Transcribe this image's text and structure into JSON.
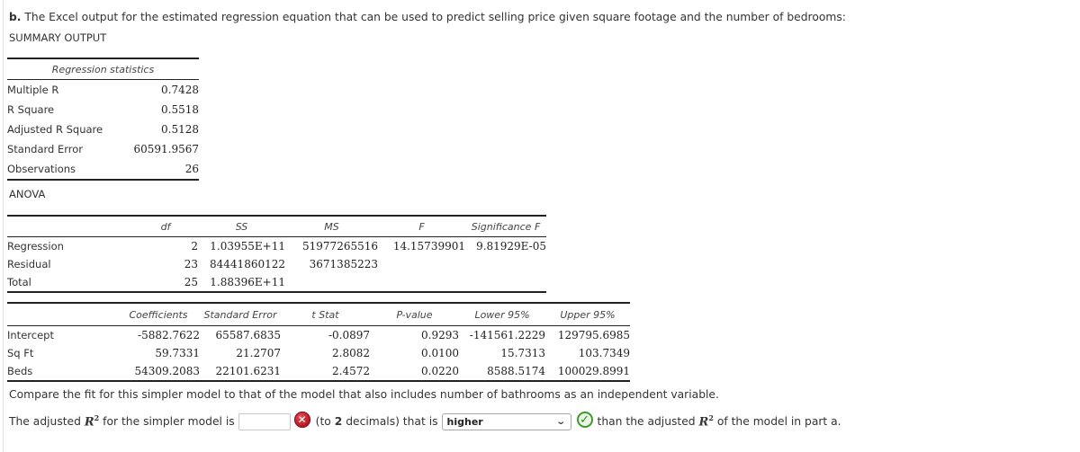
{
  "intro": {
    "part_label": "b.",
    "text": "The Excel output for the estimated regression equation that can be used to predict selling price given square footage and the number of bedrooms:"
  },
  "summary_title": "SUMMARY OUTPUT",
  "regression_statistics": {
    "header": "Regression statistics",
    "rows": [
      {
        "label": "Multiple R",
        "value": "0.7428"
      },
      {
        "label": "R Square",
        "value": "0.5518"
      },
      {
        "label": "Adjusted R Square",
        "value": "0.5128"
      },
      {
        "label": "Standard Error",
        "value": "60591.9567"
      },
      {
        "label": "Observations",
        "value": "26"
      }
    ]
  },
  "anova": {
    "title": "ANOVA",
    "headers": [
      "",
      "df",
      "SS",
      "MS",
      "F",
      "Significance F"
    ],
    "rows": [
      {
        "label": "Regression",
        "df": "2",
        "ss": "1.03955E+11",
        "ms": "51977265516",
        "f": "14.15739901",
        "sig_f": "9.81929E-05"
      },
      {
        "label": "Residual",
        "df": "23",
        "ss": "84441860122",
        "ms": "3671385223",
        "f": "",
        "sig_f": ""
      },
      {
        "label": "Total",
        "df": "25",
        "ss": "1.88396E+11",
        "ms": "",
        "f": "",
        "sig_f": ""
      }
    ]
  },
  "coefficients": {
    "headers": [
      "",
      "Coefficients",
      "Standard Error",
      "t Stat",
      "P-value",
      "Lower 95%",
      "Upper 95%"
    ],
    "rows": [
      {
        "label": "Intercept",
        "coef": "-5882.7622",
        "se": "65587.6835",
        "t": "-0.0897",
        "p": "0.9293",
        "lower": "-141561.2229",
        "upper": "129795.6985"
      },
      {
        "label": "Sq Ft",
        "coef": "59.7331",
        "se": "21.2707",
        "t": "2.8082",
        "p": "0.0100",
        "lower": "15.7313",
        "upper": "103.7349"
      },
      {
        "label": "Beds",
        "coef": "54309.2083",
        "se": "22101.6231",
        "t": "2.4572",
        "p": "0.0220",
        "lower": "8588.5174",
        "upper": "100029.8991"
      }
    ]
  },
  "compare_text": "Compare the fit for this simpler model to that of the model that also includes number of bathrooms as an independent variable.",
  "answer": {
    "prefix": "The adjusted",
    "r_symbol": "R",
    "r_exp": "2",
    "mid1": "for the simpler model is",
    "input_value": "",
    "input_status": "incorrect",
    "hint": "(to",
    "decimals": "2",
    "hint2": "decimals) that is",
    "select_value": "higher",
    "select_status": "correct",
    "suffix1": "than the adjusted",
    "suffix2": "of the model in part a.",
    "wrong_icon_glyph": "✕",
    "right_icon_glyph": "✓",
    "chevron_glyph": "⌄"
  },
  "colors": {
    "incorrect": "#c21a24",
    "correct": "#3f9a2d"
  }
}
